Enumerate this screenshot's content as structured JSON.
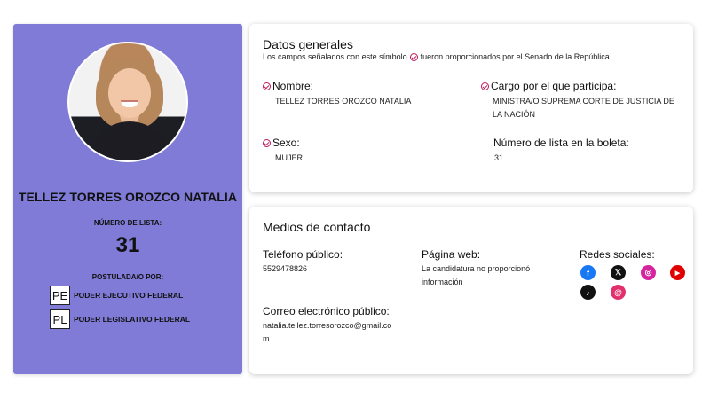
{
  "profile": {
    "name": "TELLEZ TORRES OROZCO NATALIA",
    "list_label": "NÚMERO DE LISTA:",
    "list_number": "31",
    "postulada_label": "POSTULADA/O POR:",
    "powers": [
      {
        "badge": "PE",
        "label": "PODER EJECUTIVO FEDERAL"
      },
      {
        "badge": "PL",
        "label": "PODER LEGISLATIVO FEDERAL"
      }
    ]
  },
  "general": {
    "title": "Datos generales",
    "note_before": "Los campos señalados con este símbolo",
    "note_after": "fueron proporcionados por el Senado de la República.",
    "nombre_label": "Nombre:",
    "nombre_value": "TELLEZ TORRES OROZCO NATALIA",
    "cargo_label": "Cargo por el que participa:",
    "cargo_value_line1": "MINISTRA/O SUPREMA CORTE DE JUSTICIA DE",
    "cargo_value_line2": "LA NACIÓN",
    "sexo_label": "Sexo:",
    "sexo_value": "MUJER",
    "numero_label": "Número de lista en la boleta:",
    "numero_value": "31"
  },
  "contact": {
    "title": "Medios de contacto",
    "telefono_label": "Teléfono público:",
    "telefono_value": "5529478826",
    "pagina_label": "Página web:",
    "pagina_value_line1": "La candidatura no proporcionó",
    "pagina_value_line2": "información",
    "redes_label": "Redes sociales:",
    "correo_label": "Correo electrónico público:",
    "correo_value_line1": "natalia.tellez.torresorozco@gmail.co",
    "correo_value_line2": "m",
    "socials": [
      {
        "name": "facebook-icon",
        "glyph": "f",
        "color": "#1877f2"
      },
      {
        "name": "x-icon",
        "glyph": "𝕏",
        "color": "#111111"
      },
      {
        "name": "instagram-icon",
        "glyph": "◎",
        "color": "#d6249f"
      },
      {
        "name": "youtube-icon",
        "glyph": "▶",
        "color": "#e00000"
      },
      {
        "name": "tiktok-icon",
        "glyph": "♪",
        "color": "#111111"
      },
      {
        "name": "threads-icon",
        "glyph": "@",
        "color": "#e1306c"
      }
    ]
  },
  "colors": {
    "profile_bg": "#7f7bd7",
    "check_accent": "#c2185b"
  }
}
